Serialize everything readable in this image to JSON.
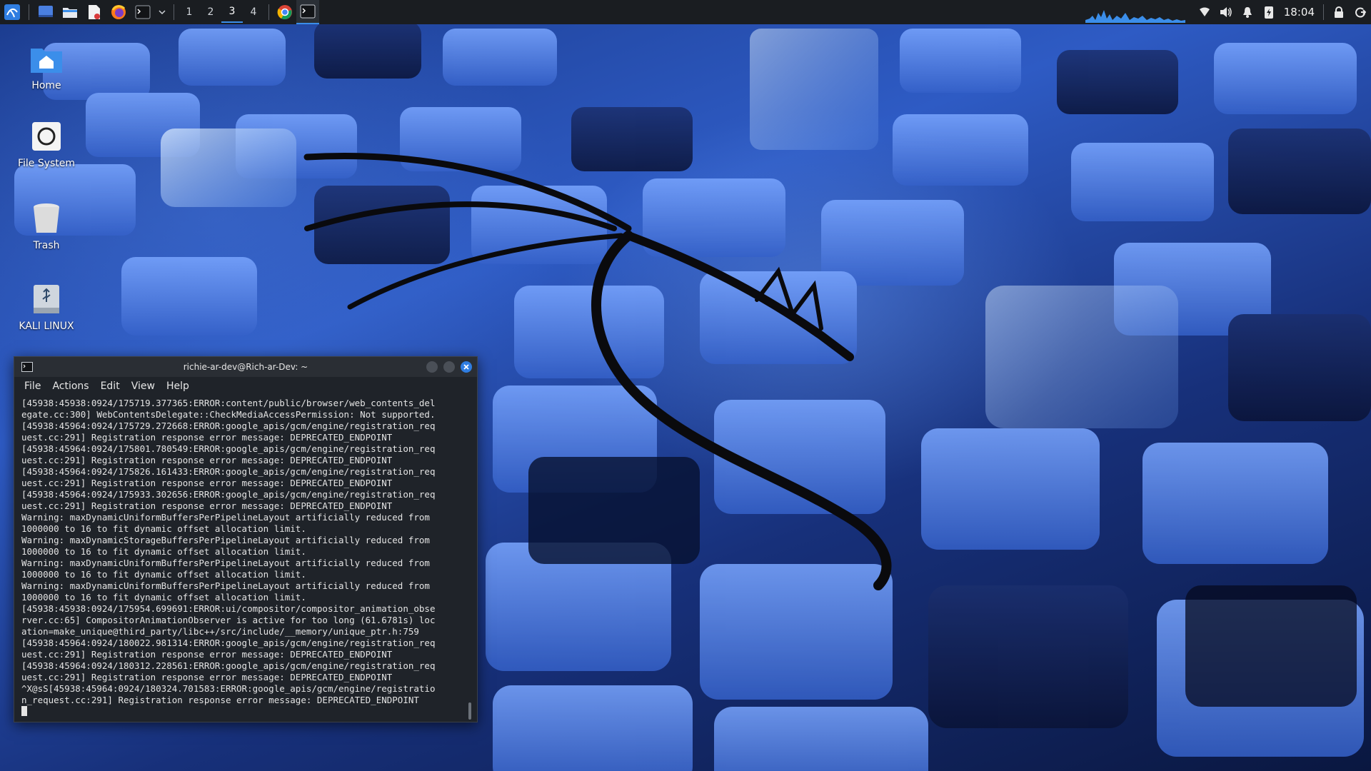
{
  "panel": {
    "workspaces": [
      "1",
      "2",
      "3",
      "4"
    ],
    "active_workspace": "3",
    "clock": "18:04",
    "accent_color": "#3b8eea",
    "launchers": [
      "kali-menu-icon",
      "show-desktop-icon",
      "file-manager-icon",
      "text-editor-icon",
      "firefox-icon",
      "terminal-icon"
    ],
    "tasks": [
      "chromium-icon",
      "terminal-icon"
    ],
    "tray": [
      "network-icon",
      "volume-icon",
      "notification-bell-icon",
      "power-icon",
      "lock-icon",
      "logout-icon"
    ]
  },
  "desktop": {
    "icons": [
      {
        "label": "Home",
        "icon": "home-folder-icon"
      },
      {
        "label": "File System",
        "icon": "filesystem-icon"
      },
      {
        "label": "Trash",
        "icon": "trash-icon"
      },
      {
        "label": "KALI LINUX",
        "icon": "usb-drive-icon"
      }
    ]
  },
  "terminal": {
    "title": "richie-ar-dev@Rich-ar-Dev: ~",
    "menu": [
      "File",
      "Actions",
      "Edit",
      "View",
      "Help"
    ],
    "lines": [
      "[45938:45938:0924/175719.377365:ERROR:content/public/browser/web_contents_del",
      "egate.cc:300] WebContentsDelegate::CheckMediaAccessPermission: Not supported.",
      "[45938:45964:0924/175729.272668:ERROR:google_apis/gcm/engine/registration_req",
      "uest.cc:291] Registration response error message: DEPRECATED_ENDPOINT",
      "[45938:45964:0924/175801.780549:ERROR:google_apis/gcm/engine/registration_req",
      "uest.cc:291] Registration response error message: DEPRECATED_ENDPOINT",
      "[45938:45964:0924/175826.161433:ERROR:google_apis/gcm/engine/registration_req",
      "uest.cc:291] Registration response error message: DEPRECATED_ENDPOINT",
      "[45938:45964:0924/175933.302656:ERROR:google_apis/gcm/engine/registration_req",
      "uest.cc:291] Registration response error message: DEPRECATED_ENDPOINT",
      "Warning: maxDynamicUniformBuffersPerPipelineLayout artificially reduced from",
      "1000000 to 16 to fit dynamic offset allocation limit.",
      "Warning: maxDynamicStorageBuffersPerPipelineLayout artificially reduced from",
      "1000000 to 16 to fit dynamic offset allocation limit.",
      "Warning: maxDynamicUniformBuffersPerPipelineLayout artificially reduced from",
      "1000000 to 16 to fit dynamic offset allocation limit.",
      "Warning: maxDynamicUniformBuffersPerPipelineLayout artificially reduced from",
      "1000000 to 16 to fit dynamic offset allocation limit.",
      "[45938:45938:0924/175954.699691:ERROR:ui/compositor/compositor_animation_obse",
      "rver.cc:65] CompositorAnimationObserver is active for too long (61.6781s) loc",
      "ation=make_unique@third_party/libc++/src/include/__memory/unique_ptr.h:759",
      "[45938:45964:0924/180022.981314:ERROR:google_apis/gcm/engine/registration_req",
      "uest.cc:291] Registration response error message: DEPRECATED_ENDPOINT",
      "[45938:45964:0924/180312.228561:ERROR:google_apis/gcm/engine/registration_req",
      "uest.cc:291] Registration response error message: DEPRECATED_ENDPOINT",
      "^X@sS[45938:45964:0924/180324.701583:ERROR:google_apis/gcm/engine/registratio",
      "n_request.cc:291] Registration response error message: DEPRECATED_ENDPOINT"
    ]
  }
}
